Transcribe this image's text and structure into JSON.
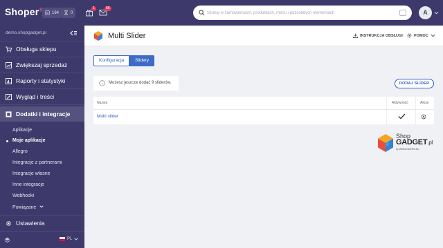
{
  "topbar": {
    "logo": "Shoper",
    "logo_mark": "®",
    "stats": [
      {
        "icon": "products-icon",
        "value": "164"
      },
      {
        "icon": "hourglass-icon",
        "value": "0"
      }
    ],
    "gift_badge": "1",
    "mail_badge": "66",
    "search_placeholder": "Szukaj w zamówieniach, produktach, menu i pozostałych elementach",
    "avatar_initial": "A"
  },
  "sidebar": {
    "store_url": "demo.shopgadget.pl",
    "items": [
      {
        "label": "Obsługa sklepu",
        "icon": "cart-icon"
      },
      {
        "label": "Zwiększaj sprzedaż",
        "icon": "chart-up-icon"
      },
      {
        "label": "Raporty i statystyki",
        "icon": "bar-chart-icon"
      },
      {
        "label": "Wygląd i treści",
        "icon": "brush-icon"
      },
      {
        "label": "Dodatki i integracje",
        "icon": "puzzle-icon"
      }
    ],
    "sub_items": [
      {
        "label": "Aplikacje"
      },
      {
        "label": "Moje aplikacje"
      },
      {
        "label": "Allegro"
      },
      {
        "label": "Integracje z partnerami"
      },
      {
        "label": "Integracje własne"
      },
      {
        "label": "Inne integracje"
      },
      {
        "label": "Webhooki"
      },
      {
        "label": "Powiązane"
      }
    ],
    "settings_label": "Ustawienia",
    "language": "PL"
  },
  "header": {
    "title": "Multi Slider",
    "instructions": "INSTRUKCJA OBSŁUGI",
    "help": "POMOC"
  },
  "tabs": [
    {
      "label": "Konfiguracja",
      "active": false
    },
    {
      "label": "Slidery",
      "active": true
    }
  ],
  "info": {
    "text": "Możesz jeszcze dodać 9 sliderów."
  },
  "add_button": "DODAJ SLIDER",
  "table": {
    "columns": [
      "Nazwa",
      "Aktywność",
      "Akcje"
    ],
    "rows": [
      {
        "name": "Multi slider",
        "active": true
      }
    ]
  },
  "brand": {
    "shop": "Shop",
    "gadget": "GADGET",
    "tld": ".pl",
    "by": "by WEBCODERS.EU"
  },
  "colors": {
    "sidebar_bg": "#3d3a6b",
    "accent": "#3d6bc7",
    "badge": "#e5395a",
    "content_bg": "#f0f1f5"
  }
}
